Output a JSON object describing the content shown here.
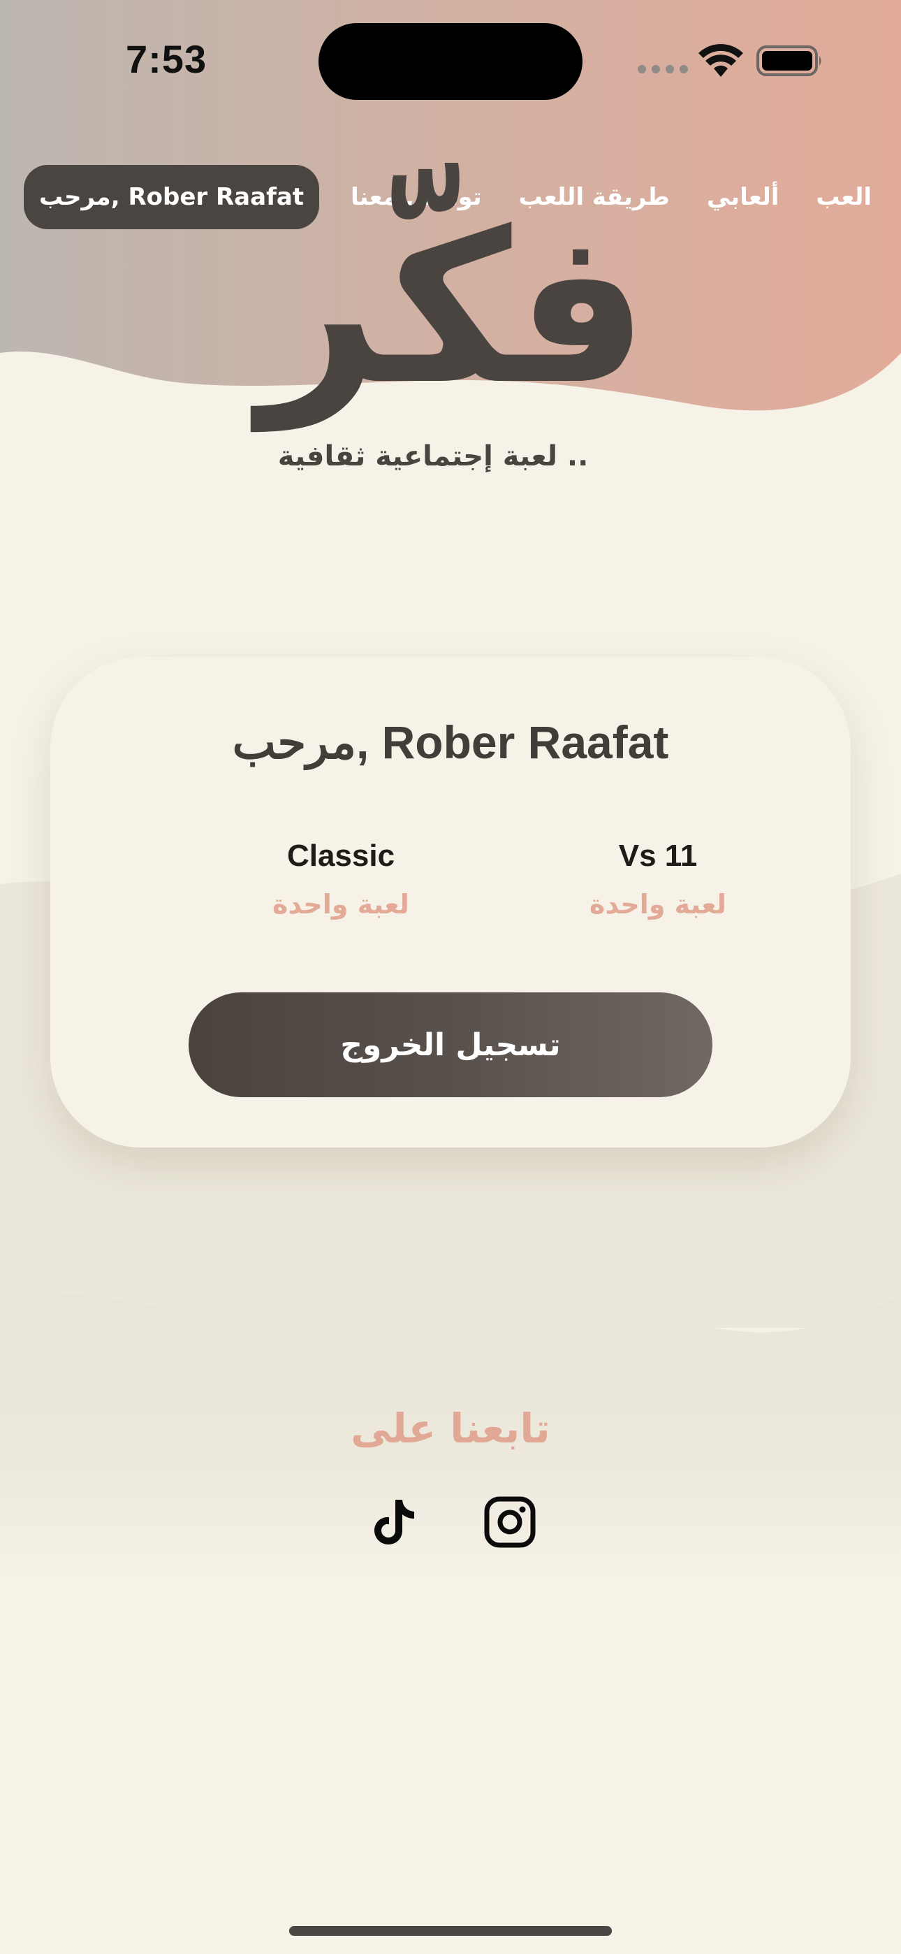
{
  "status_bar": {
    "time": "7:53"
  },
  "nav": {
    "links": [
      "العب",
      "ألعابي",
      "طريقة اللعب",
      "تواصل معنا"
    ],
    "user_greeting": "مرحب, Rober Raafat"
  },
  "brand": {
    "logo_text": "فكّر",
    "tagline": "لعبة إجتماعية ثقافية .."
  },
  "card": {
    "greeting": "مرحب, Rober Raafat",
    "stats": [
      {
        "value": "Vs 11",
        "label": "لعبة واحدة"
      },
      {
        "value": "Classic",
        "label": "لعبة واحدة"
      }
    ],
    "logout_label": "تسجيل الخروج"
  },
  "footer": {
    "follow_title": "تابعنا على",
    "social_icons": [
      "instagram-icon",
      "tiktok-icon"
    ]
  },
  "colors": {
    "background": "#f6f2e8",
    "header_gradient_start": "#b9b5b0",
    "header_gradient_end": "#e2ab9a",
    "dark_brown": "#4a4440",
    "accent_peach": "#e3aa98",
    "wave_beige": "#e9e5d8"
  }
}
